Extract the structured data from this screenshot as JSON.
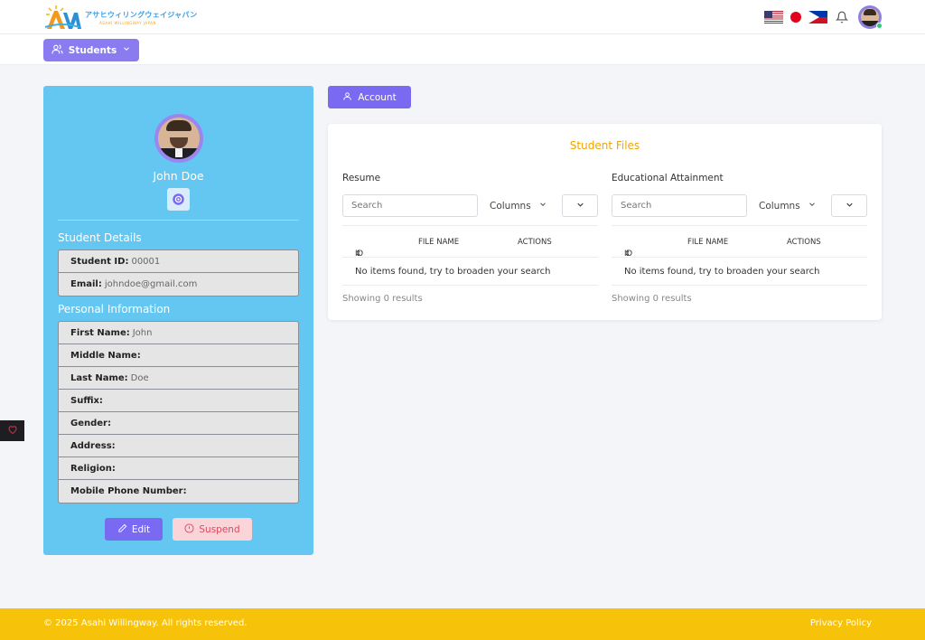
{
  "header": {
    "logo_jp": "アサヒウィリングウェイジャパン",
    "logo_en": "ASAHI WILLINGWAY JAPAN",
    "icons": [
      "flag-us-icon",
      "flag-jp-icon",
      "flag-ph-icon",
      "bell-icon",
      "user-avatar"
    ]
  },
  "nav": {
    "students_label": "Students"
  },
  "profile": {
    "name": "John Doe",
    "student_details_title": "Student Details",
    "student_details": [
      {
        "label": "Student ID:",
        "value": "00001"
      },
      {
        "label": "Email:",
        "value": "johndoe@gmail.com"
      }
    ],
    "personal_info_title": "Personal Information",
    "personal_info": [
      {
        "label": "First Name:",
        "value": "John"
      },
      {
        "label": "Middle Name:",
        "value": ""
      },
      {
        "label": "Last Name:",
        "value": "Doe"
      },
      {
        "label": "Suffix:",
        "value": ""
      },
      {
        "label": "Gender:",
        "value": ""
      },
      {
        "label": "Address:",
        "value": ""
      },
      {
        "label": "Religion:",
        "value": ""
      },
      {
        "label": "Mobile Phone Number:",
        "value": ""
      }
    ],
    "edit_label": "Edit",
    "suspend_label": "Suspend"
  },
  "account_label": "Account",
  "files": {
    "title": "Student Files",
    "panels": [
      {
        "title": "Resume",
        "search_placeholder": "Search",
        "columns_label": "Columns",
        "headers": [
          "ID",
          "FILE NAME",
          "ACTIONS"
        ],
        "empty_text": "No items found, try to broaden your search",
        "footer": "Showing 0 results"
      },
      {
        "title": "Educational Attainment",
        "search_placeholder": "Search",
        "columns_label": "Columns",
        "headers": [
          "ID",
          "FILE NAME",
          "ACTIONS"
        ],
        "empty_text": "No items found, try to broaden your search",
        "footer": "Showing 0 results"
      }
    ]
  },
  "footer": {
    "copyright": "© 2025 Asahi Willingway. All rights reserved.",
    "privacy": "Privacy Policy"
  },
  "colors": {
    "accent": "#7a6af2",
    "profile_bg": "#63c7f1",
    "files_title": "#f0a500",
    "footer_bg": "#f7c20a",
    "suspend_text": "#e0485e"
  }
}
